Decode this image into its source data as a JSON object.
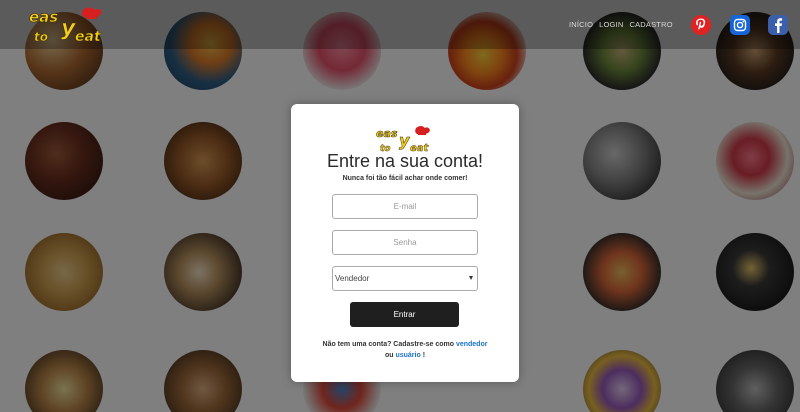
{
  "brand": {
    "logo_text": "Easy to eat"
  },
  "nav": {
    "items": [
      "INÍCIO",
      "LOGIN",
      "CADASTRO"
    ]
  },
  "social": {
    "pinterest": "pinterest-icon",
    "instagram": "instagram-icon",
    "facebook": "facebook-icon"
  },
  "modal": {
    "title": "Entre na sua conta!",
    "subtitle": "Nunca foi tão fácil achar onde comer!",
    "email_placeholder": "E-mail",
    "password_placeholder": "Senha",
    "select_value": "Vendedor",
    "submit_label": "Entrar",
    "signup_prefix": "Não tem uma conta? Cadastre-se como",
    "signup_seller": "vendedor",
    "signup_or": "ou",
    "signup_user": "usuário",
    "signup_end": "!"
  },
  "colors": {
    "overlay": "#000000",
    "link": "#1a73c8",
    "submit_bg": "#1f1f1f",
    "pinterest": "#e02222",
    "instagram": "#1565d8",
    "facebook": "#3b5fa9"
  }
}
